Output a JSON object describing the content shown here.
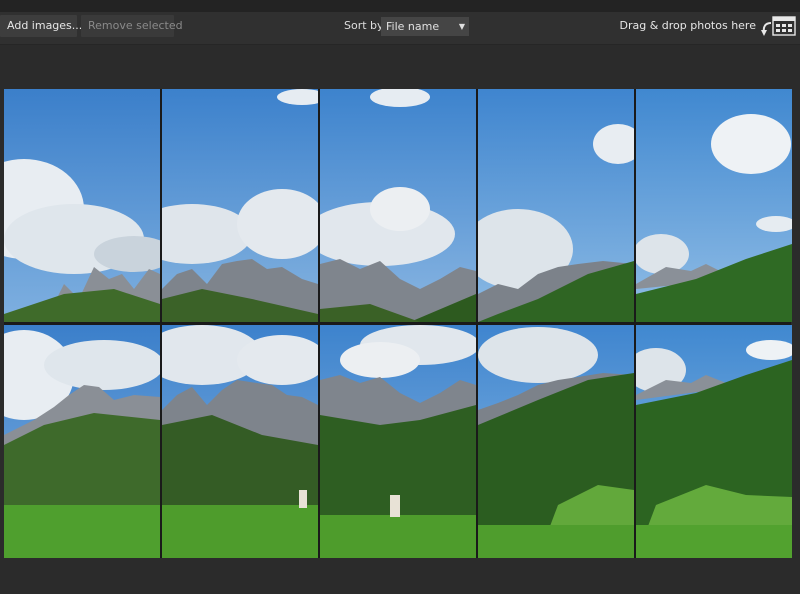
{
  "toolbar": {
    "add_label": "Add images...",
    "remove_label": "Remove selected",
    "sort_label": "Sort by",
    "sort_value": "File name",
    "drop_label": "Drag & drop photos here"
  },
  "icons": {
    "sort_chevron": "chevron-down-icon",
    "drop_target": "drag-drop-icon"
  },
  "gallery": {
    "rows": 2,
    "columns": 5,
    "tile_count": 10,
    "subject": "mountain landscape photo tiles"
  },
  "colors": {
    "background": "#2b2b2b",
    "toolbar": "#303030",
    "button": "#3d3d3d",
    "sky": "#3f86cf",
    "grass": "#4a9a2c"
  }
}
